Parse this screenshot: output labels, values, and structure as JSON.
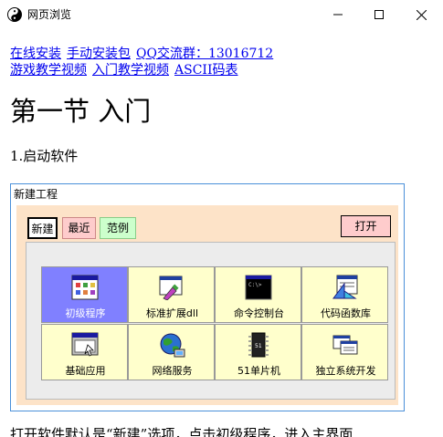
{
  "window": {
    "title": "网页浏览",
    "minimize_icon": "minimize-icon",
    "maximize_icon": "maximize-icon",
    "close_icon": "close-icon"
  },
  "links": [
    "在线安装",
    "手动安装包",
    "QQ交流群：13016712",
    "游戏教学视频",
    "入门教学视频",
    "ASCII码表"
  ],
  "page": {
    "heading": "第一节 入门",
    "step": "1.启动软件",
    "bottom_text": "打开软件默认是“新建”选项，点击初级程序，进入主界面"
  },
  "dialog": {
    "title": "新建工程",
    "tabs": [
      "新建",
      "最近",
      "范例"
    ],
    "active_tab": "新建",
    "open_button": "打开",
    "tiles": [
      {
        "label": "初级程序",
        "icon": "program-grid-icon",
        "selected": true
      },
      {
        "label": "标准扩展dll",
        "icon": "dll-window-icon",
        "selected": false
      },
      {
        "label": "命令控制台",
        "icon": "console-icon",
        "selected": false
      },
      {
        "label": "代码函数库",
        "icon": "code-library-icon",
        "selected": false
      },
      {
        "label": "基础应用",
        "icon": "basic-app-icon",
        "selected": false
      },
      {
        "label": "网络服务",
        "icon": "network-globe-icon",
        "selected": false
      },
      {
        "label": "51单片机",
        "icon": "chip-icon",
        "selected": false
      },
      {
        "label": "独立系统开发",
        "icon": "system-dev-icon",
        "selected": false
      }
    ]
  },
  "colors": {
    "link": "#0000ee",
    "dialog_border": "#4a90d9",
    "panel_bg": "#fde3c8",
    "tile_bg": "#ffffcc",
    "tile_selected": "#8080ff",
    "tab_recent": "#fecccc",
    "tab_examples": "#ccffcc"
  }
}
